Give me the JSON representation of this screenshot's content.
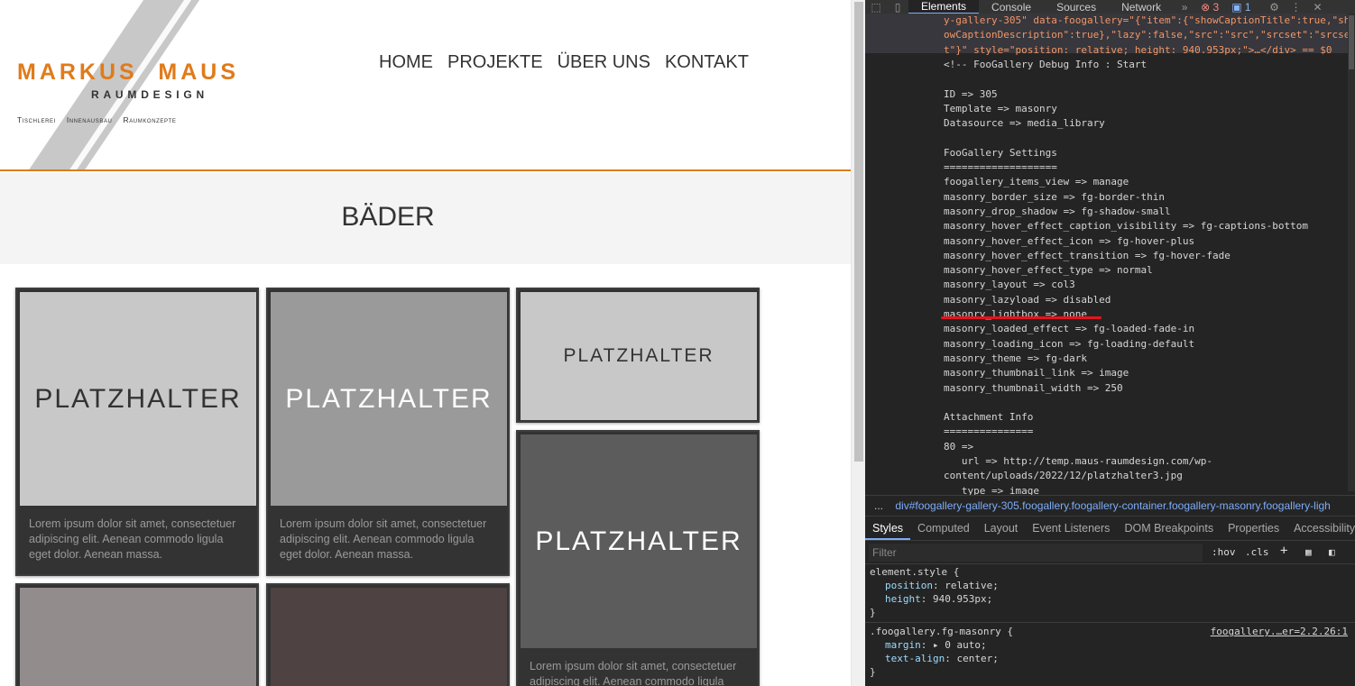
{
  "site": {
    "logo": {
      "word1": "MARKUS",
      "word2": "MAUS",
      "subtitle": "RAUMDESIGN",
      "tagline": [
        "Tischlerei",
        "Innenausbau",
        "Raumkonzepte"
      ]
    },
    "nav": [
      "HOME",
      "PROJEKTE",
      "ÜBER UNS",
      "KONTAKT"
    ],
    "page_title": "BÄDER",
    "placeholder_text": "PLATZHALTER",
    "caption": "Lorem ipsum dolor sit amet, consectetuer adipiscing elit. Aenean commodo ligula eget dolor. Aenean massa.",
    "colors": {
      "accent": "#e07b1a",
      "tile_bg": "#333333"
    }
  },
  "devtools": {
    "tabs": [
      "Elements",
      "Console",
      "Sources",
      "Network"
    ],
    "error_count": "3",
    "message_count": "1",
    "dom_lines": [
      "y-gallery-305\" data-foogallery=\"{\"item\":{\"showCaptionTitle\":true,\"sh",
      "owCaptionDescription\":true},\"lazy\":false,\"src\":\"src\",\"srcset\":\"srcse",
      "t\"}\" style=\"position: relative; height: 940.953px;\">…</div> == $0",
      "<!-- FooGallery Debug Info : Start",
      "",
      "ID => 305",
      "Template => masonry",
      "Datasource => media_library",
      "",
      "FooGallery Settings",
      "===================",
      "foogallery_items_view => manage",
      "masonry_border_size => fg-border-thin",
      "masonry_drop_shadow => fg-shadow-small",
      "masonry_hover_effect_caption_visibility => fg-captions-bottom",
      "masonry_hover_effect_icon => fg-hover-plus",
      "masonry_hover_effect_transition => fg-hover-fade",
      "masonry_hover_effect_type => normal",
      "masonry_layout => col3",
      "masonry_lazyload => disabled",
      "masonry_lightbox => none",
      "masonry_loaded_effect => fg-loaded-fade-in",
      "masonry_loading_icon => fg-loading-default",
      "masonry_theme => fg-dark",
      "masonry_thumbnail_link => image",
      "masonry_thumbnail_width => 250",
      "",
      "Attachment Info",
      "===============",
      "80 =>",
      "   url => http://temp.maus-raumdesign.com/wp-",
      "content/uploads/2022/12/platzhalter3.jpg",
      "   type => image"
    ],
    "breadcrumb_dots": "...",
    "breadcrumb": "div#foogallery-gallery-305.foogallery.foogallery-container.foogallery-masonry.foogallery-ligh",
    "sub_tabs": [
      "Styles",
      "Computed",
      "Layout",
      "Event Listeners",
      "DOM Breakpoints",
      "Properties",
      "Accessibility"
    ],
    "filter_placeholder": "Filter",
    "hov": ":hov",
    "cls": ".cls",
    "rule1": {
      "selector": "element.style {",
      "p1": "position",
      "v1": "relative;",
      "p2": "height",
      "v2": "940.953px;",
      "close": "}"
    },
    "rule2": {
      "selector": ".foogallery.fg-masonry {",
      "source": "foogallery.…er=2.2.26:1",
      "p1": "margin",
      "v1": "▸ 0 auto;",
      "p2": "text-align",
      "v2": "center;",
      "close": "}"
    }
  }
}
